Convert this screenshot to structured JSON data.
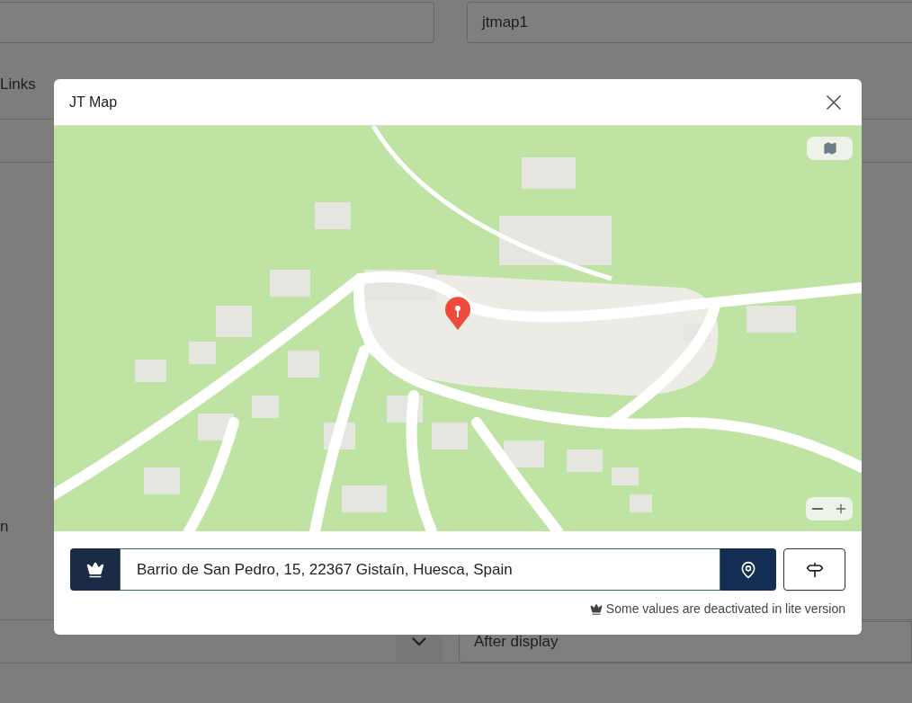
{
  "page": {
    "name_field": {
      "value": "jtmap1"
    },
    "links_label": "Links",
    "cut_label": "n",
    "display_field": {
      "value": "After display"
    }
  },
  "modal": {
    "title": "JT Map",
    "address_field": {
      "value": "Barrio de San Pedro, 15, 22367 Gistaín, Huesca, Spain"
    },
    "note": "Some values are deactivated in lite version"
  }
}
